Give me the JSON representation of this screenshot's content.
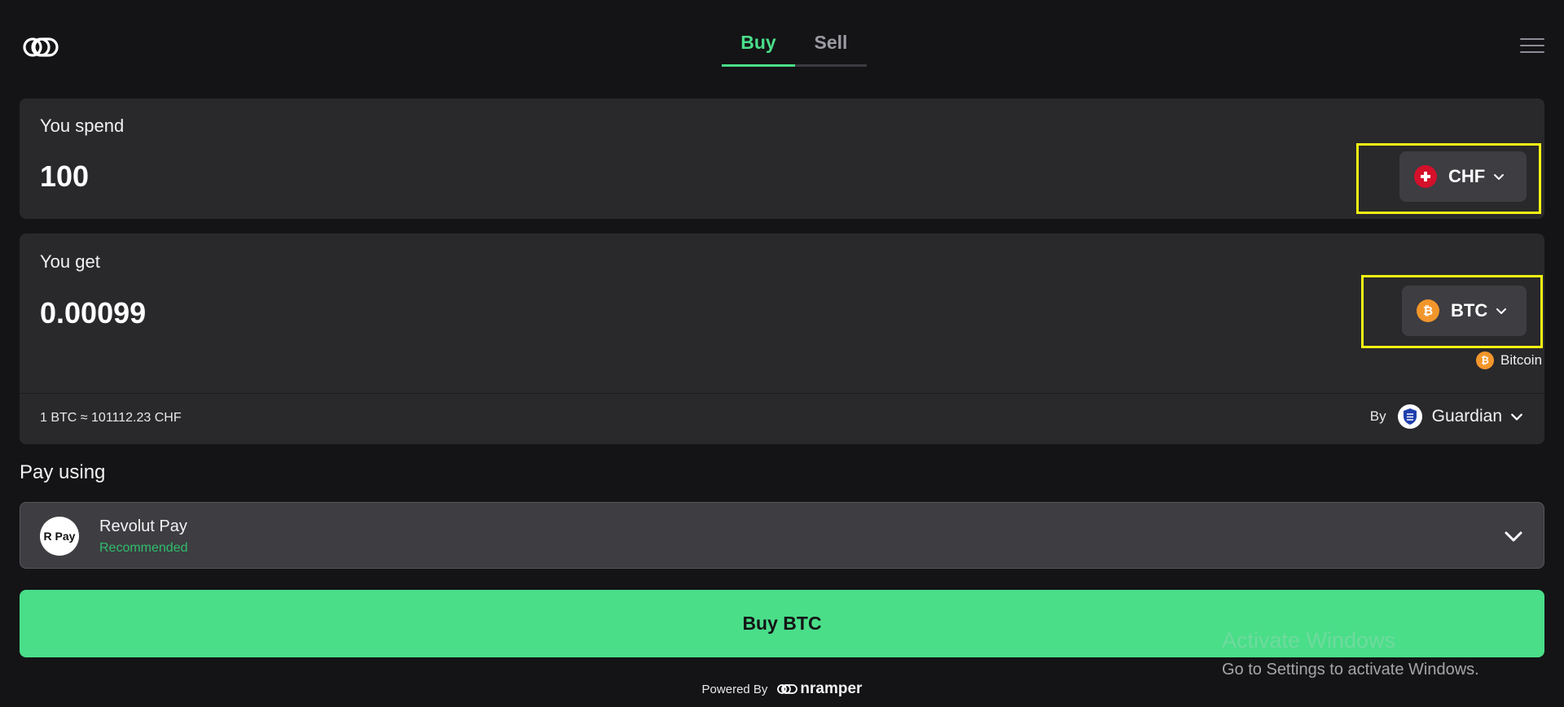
{
  "header": {
    "logo_icon": "onramper-logo-icon",
    "tabs": [
      {
        "label": "Buy",
        "active": true
      },
      {
        "label": "Sell",
        "active": false
      }
    ],
    "menu_icon": "hamburger-menu-icon"
  },
  "spend": {
    "label": "You spend",
    "amount": "100",
    "currency": "CHF",
    "currency_icon": "swiss-flag-icon"
  },
  "get": {
    "label": "You get",
    "amount": "0.00099",
    "currency": "BTC",
    "currency_icon": "bitcoin-icon",
    "network": "Bitcoin",
    "rate": "1 BTC ≈ 101112.23 CHF",
    "provider_prefix": "By",
    "provider": "Guardian"
  },
  "payment": {
    "label": "Pay using",
    "method": "Revolut Pay",
    "badge": "Recommended",
    "method_icon_text": "R Pay"
  },
  "buy_button": "Buy BTC",
  "footer": {
    "powered_by": "Powered By",
    "brand": "nramper"
  },
  "watermark": {
    "title": "Activate Windows",
    "subtitle": "Go to Settings to activate Windows."
  },
  "colors": {
    "accent": "#4ade89",
    "background": "#141416",
    "card": "#29292c",
    "highlight": "#f5f513",
    "bitcoin": "#f2962b",
    "swiss_red": "#d4102a"
  }
}
